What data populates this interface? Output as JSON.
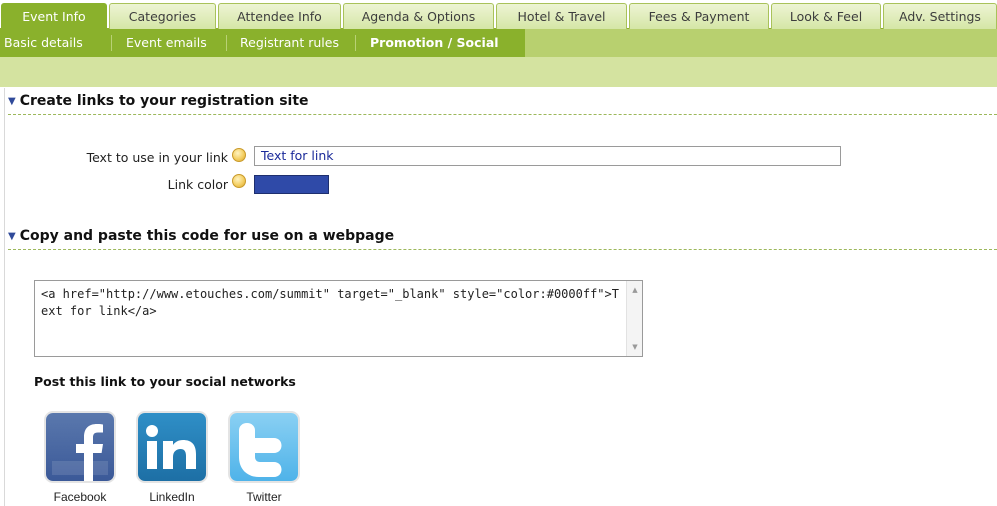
{
  "main_tabs": [
    {
      "label": "Event Info",
      "active": true
    },
    {
      "label": "Categories",
      "active": false
    },
    {
      "label": "Attendee Info",
      "active": false
    },
    {
      "label": "Agenda & Options",
      "active": false
    },
    {
      "label": "Hotel & Travel",
      "active": false
    },
    {
      "label": "Fees & Payment",
      "active": false
    },
    {
      "label": "Look & Feel",
      "active": false
    },
    {
      "label": "Adv. Settings",
      "active": false
    }
  ],
  "sub_tabs": [
    {
      "label": "Basic details",
      "active": false
    },
    {
      "label": "Event emails",
      "active": false
    },
    {
      "label": "Registrant rules",
      "active": false
    },
    {
      "label": "Promotion / Social",
      "active": true
    }
  ],
  "create_links": {
    "heading": "Create links to your registration site",
    "link_text_label": "Text to use in your link",
    "link_text_value": "Text for link",
    "link_color_label": "Link color",
    "link_color_value": "#2f4aa8"
  },
  "copy_code": {
    "heading": "Copy and paste this code for use on a webpage",
    "code": "<a href=\"http://www.etouches.com/summit\" target=\"_blank\" style=\"color:#0000ff\">Text for link</a>"
  },
  "social": {
    "heading": "Post this link to your social networks",
    "networks": [
      {
        "label": "Facebook",
        "icon": "facebook-icon"
      },
      {
        "label": "LinkedIn",
        "icon": "linkedin-icon"
      },
      {
        "label": "Twitter",
        "icon": "twitter-icon"
      }
    ]
  },
  "colors": {
    "tab_active": "#8ab12c",
    "subtab_bar": "#8ab12c",
    "band": "#d4e3a0",
    "accent_blue": "#304a9a"
  }
}
